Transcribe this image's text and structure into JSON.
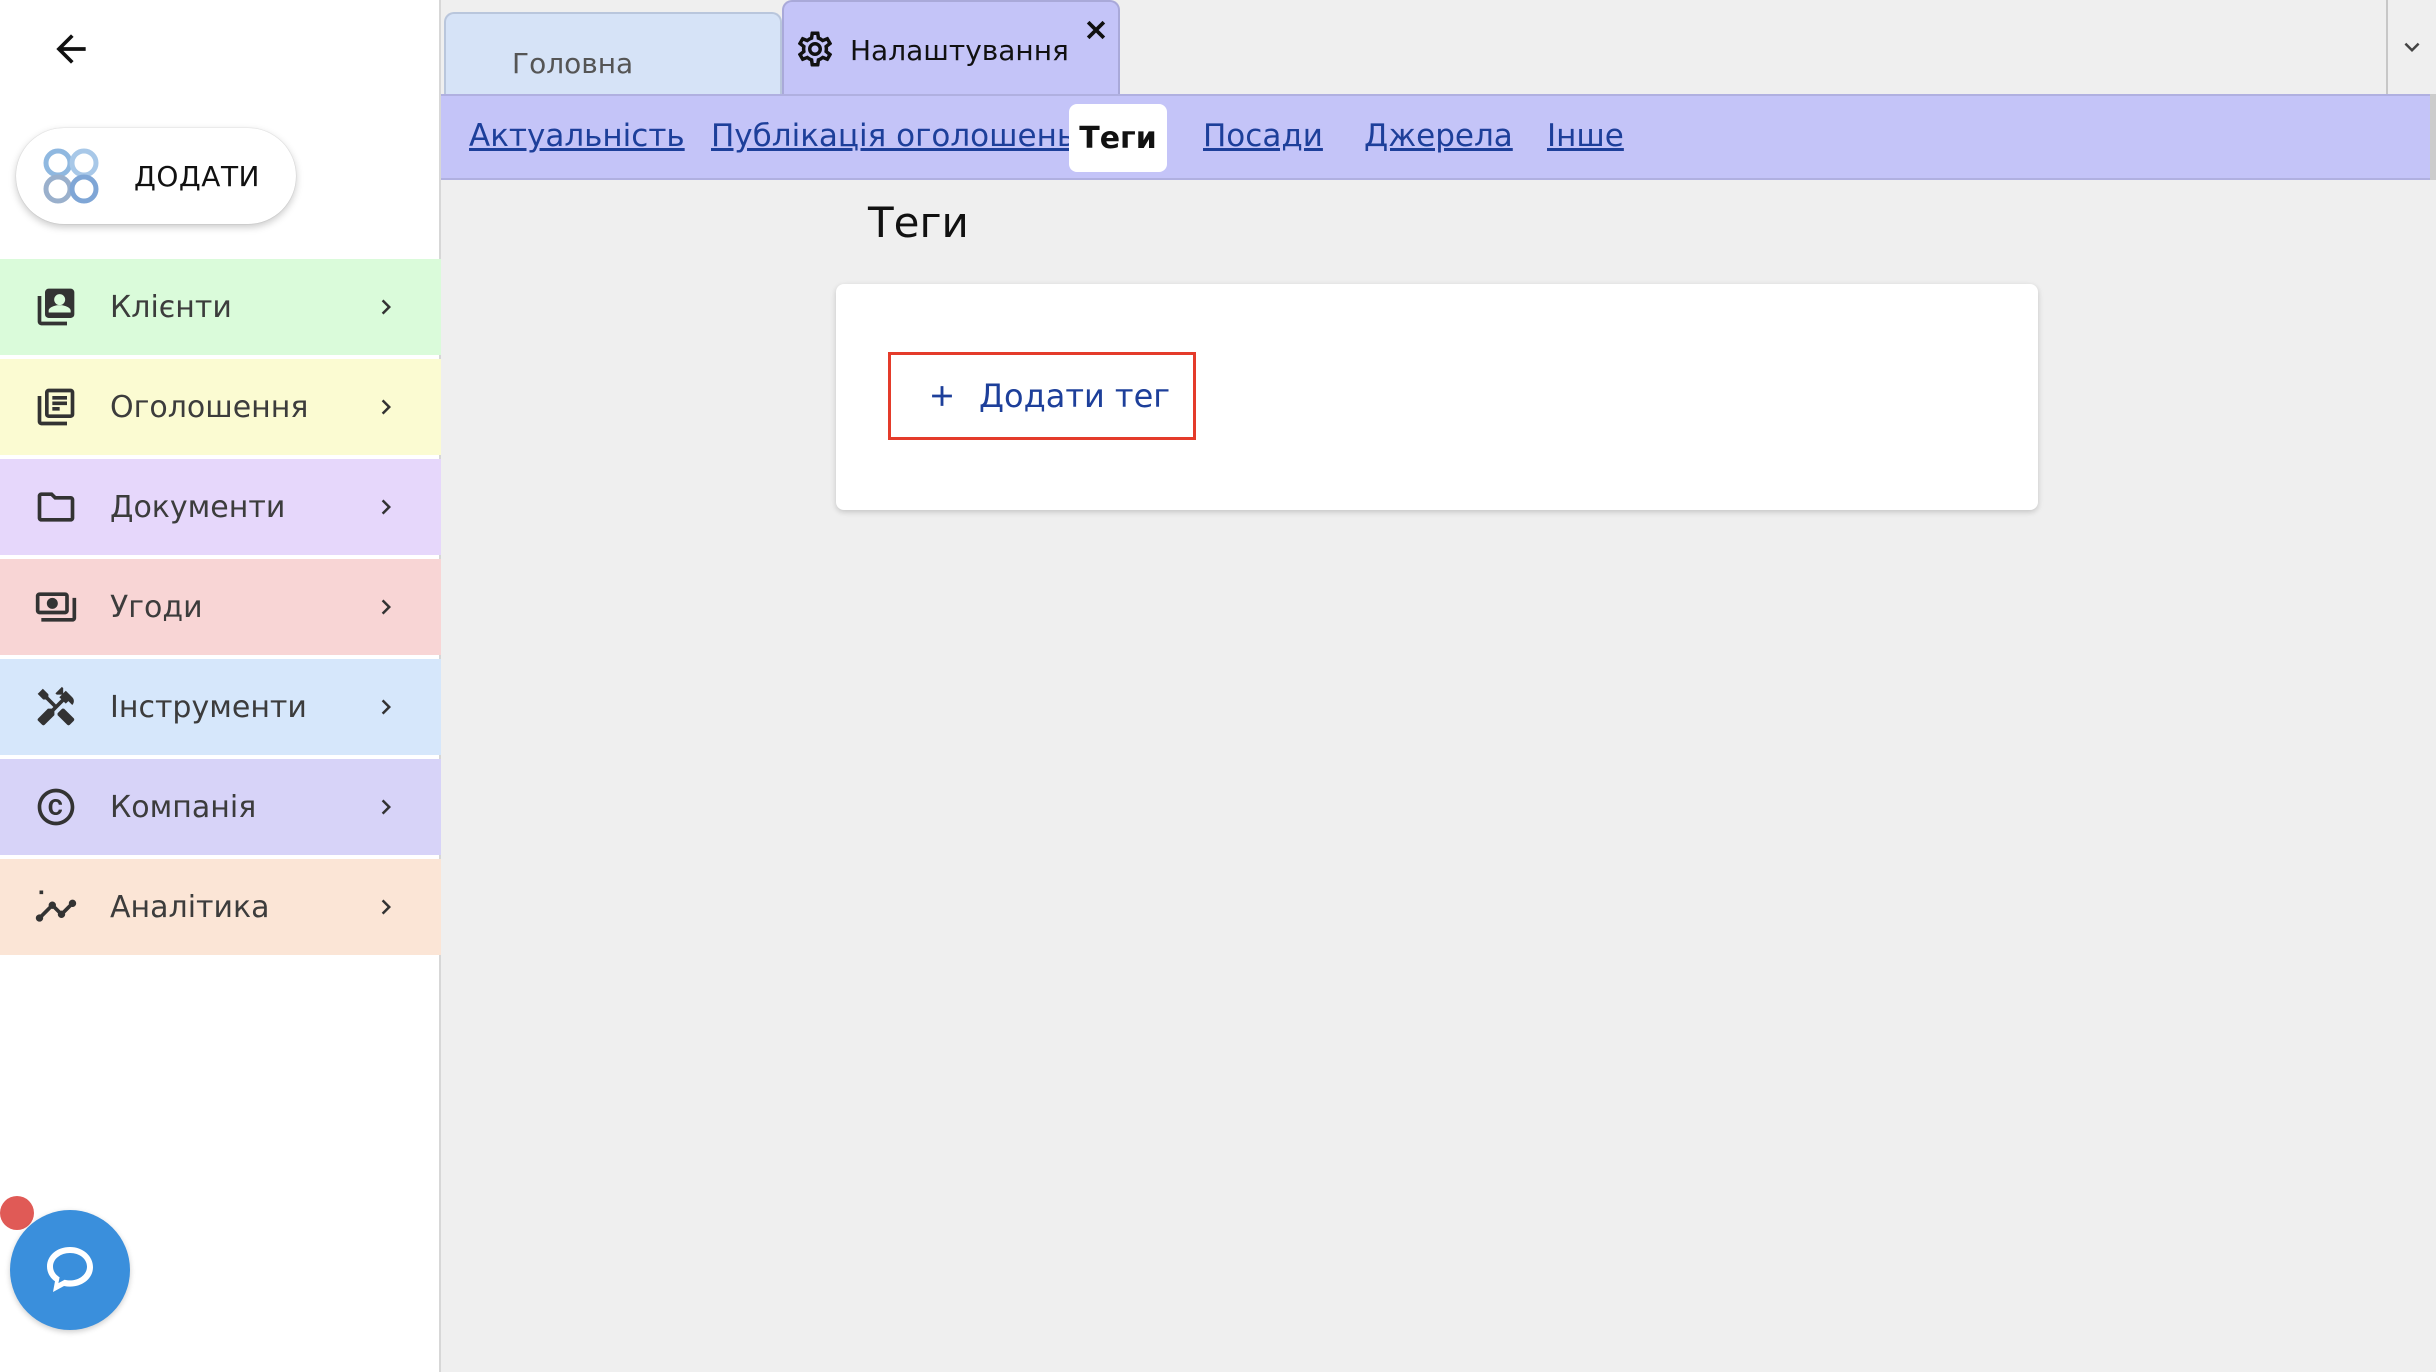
{
  "sidebar": {
    "add_button_label": "ДОДАТИ",
    "items": [
      {
        "label": "Клієнти",
        "icon": "contacts-icon",
        "color": "#dafbda"
      },
      {
        "label": "Оголошення",
        "icon": "listings-icon",
        "color": "#fbfbd2"
      },
      {
        "label": "Документи",
        "icon": "folder-icon",
        "color": "#e6d7fb"
      },
      {
        "label": "Угоди",
        "icon": "payments-icon",
        "color": "#f8d5d5"
      },
      {
        "label": "Інструменти",
        "icon": "tools-icon",
        "color": "#d6e7fb"
      },
      {
        "label": "Компанія",
        "icon": "copyright-icon",
        "color": "#d7d3f8"
      },
      {
        "label": "Аналітика",
        "icon": "analytics-icon",
        "color": "#fbe5d6"
      }
    ]
  },
  "tabs": {
    "home_label": "Головна",
    "settings_label": "Налаштування"
  },
  "subnav": {
    "links": [
      "Актуальність",
      "Публікація оголошень",
      "Теги",
      "Посади",
      "Джерела",
      "Інше"
    ],
    "active_index": 2
  },
  "main": {
    "title": "Теги",
    "add_tag_label": "Додати тег"
  },
  "colors": {
    "accent": "#1d3f9a",
    "subnav_bg": "#c4c4f8",
    "highlight": "#e43b2a"
  }
}
